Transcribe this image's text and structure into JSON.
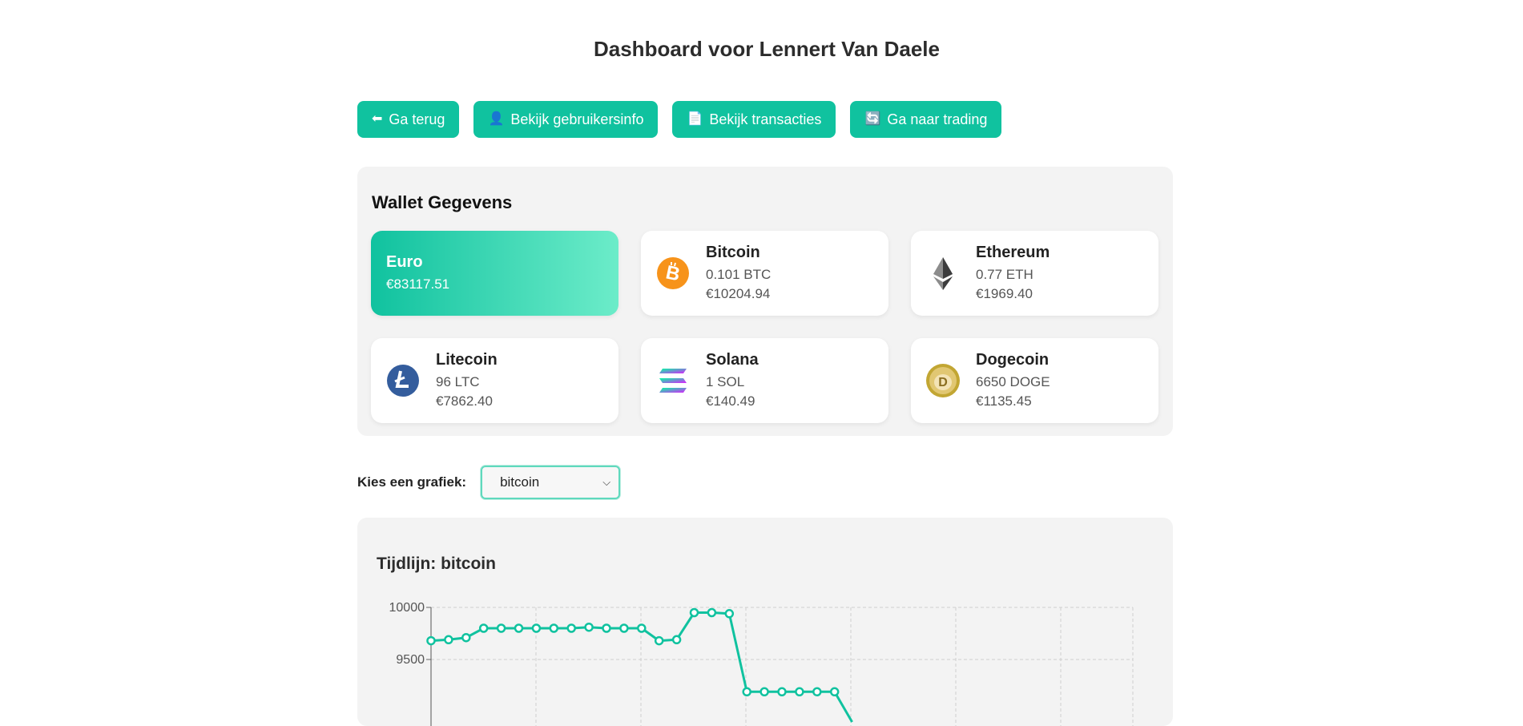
{
  "title": "Dashboard voor Lennert Van Daele",
  "nav": [
    {
      "icon": "⬅",
      "label": "Ga terug"
    },
    {
      "icon": "👤",
      "label": "Bekijk gebruikersinfo"
    },
    {
      "icon": "📄",
      "label": "Bekijk transacties"
    },
    {
      "icon": "🔄",
      "label": "Ga naar trading"
    }
  ],
  "wallet": {
    "heading": "Wallet Gegevens",
    "euro": {
      "name": "Euro",
      "value": "€83117.51"
    },
    "coins": [
      {
        "name": "Bitcoin",
        "amount": "0.101 BTC",
        "value": "€10204.94",
        "icon": "bitcoin-icon",
        "color": "#f7931a"
      },
      {
        "name": "Ethereum",
        "amount": "0.77 ETH",
        "value": "€1969.40",
        "icon": "ethereum-icon",
        "color": "#3c3c3d"
      },
      {
        "name": "Litecoin",
        "amount": "96 LTC",
        "value": "€7862.40",
        "icon": "litecoin-icon",
        "color": "#345d9d"
      },
      {
        "name": "Solana",
        "amount": "1 SOL",
        "value": "€140.49",
        "icon": "solana-icon",
        "color": "#9945ff"
      },
      {
        "name": "Dogecoin",
        "amount": "6650 DOGE",
        "value": "€1135.45",
        "icon": "dogecoin-icon",
        "color": "#c2a633"
      }
    ]
  },
  "selector": {
    "label": "Kies een grafiek:",
    "selected": "bitcoin"
  },
  "chart": {
    "heading": "Tijdlijn: bitcoin"
  },
  "chart_data": {
    "type": "line",
    "title": "",
    "xlabel": "",
    "ylabel": "",
    "y_ticks": [
      10000,
      9500
    ],
    "grid": true,
    "color": "#10c29f",
    "values": [
      9680,
      9690,
      9710,
      9800,
      9800,
      9800,
      9800,
      9800,
      9800,
      9810,
      9800,
      9800,
      9800,
      9680,
      9690,
      9950,
      9950,
      9940,
      9190,
      9190,
      9190,
      9190,
      9190,
      9190,
      8900
    ]
  },
  "colors": {
    "accent": "#10c29f",
    "panel": "#f3f3f3"
  }
}
